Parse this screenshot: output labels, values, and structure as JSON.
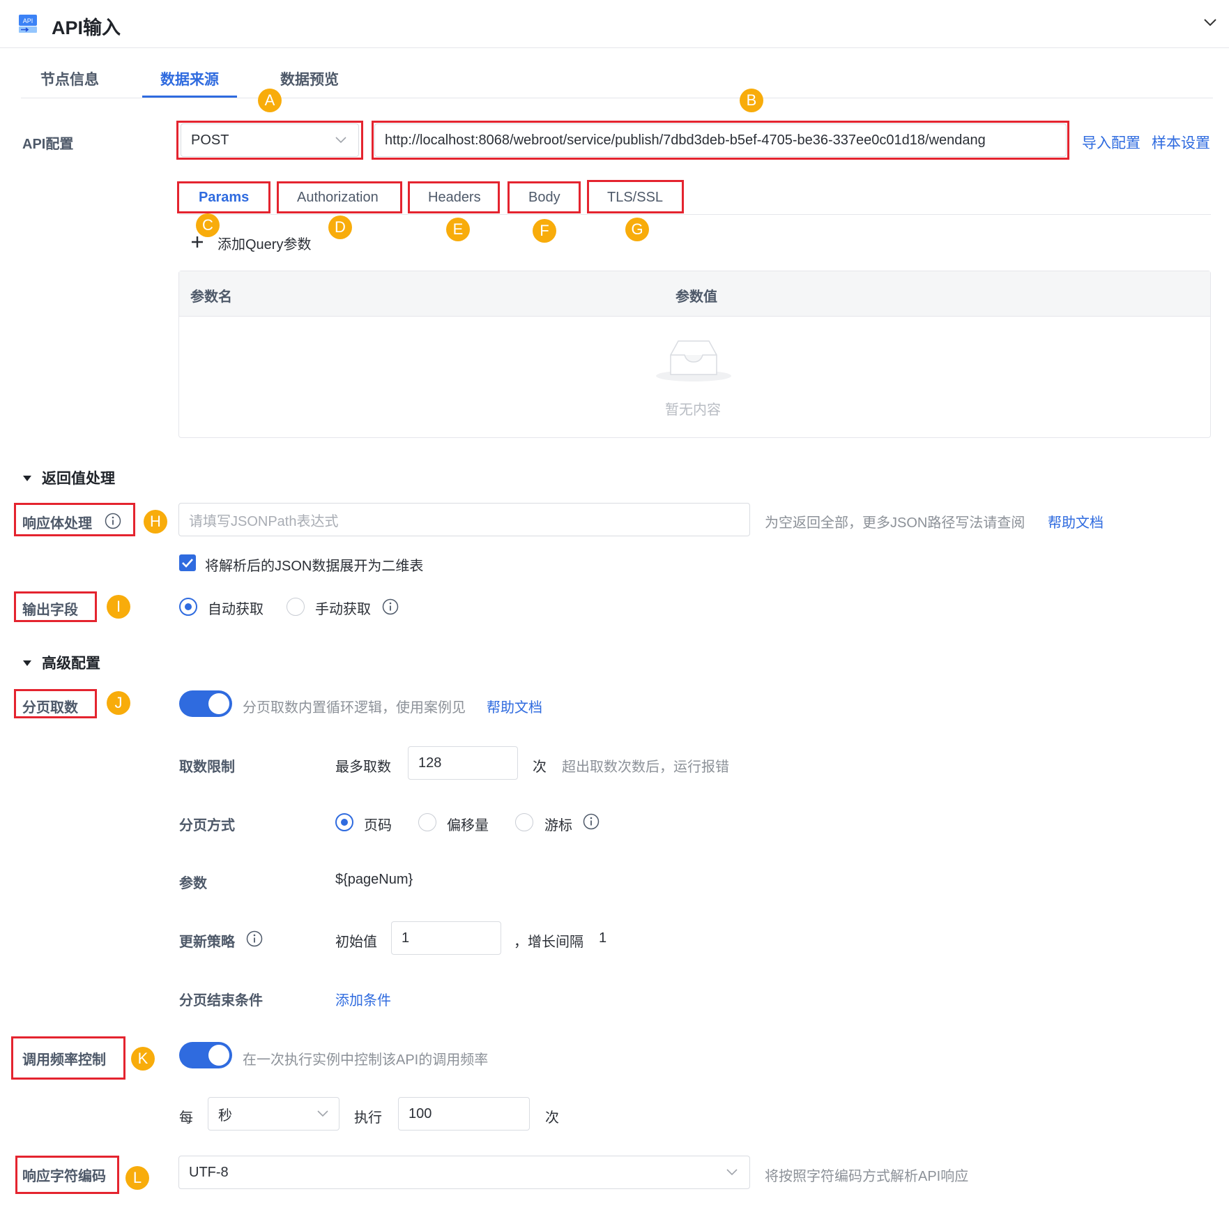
{
  "header": {
    "title": "API输入",
    "icon": "api-icon"
  },
  "tabs": [
    {
      "label": "节点信息",
      "active": false
    },
    {
      "label": "数据来源",
      "active": true
    },
    {
      "label": "数据预览",
      "active": false
    }
  ],
  "api_config": {
    "label": "API配置",
    "method": "POST",
    "url": "http://localhost:8068/webroot/service/publish/7dbd3deb-b5ef-4705-be36-337ee0c01d18/wendang",
    "import_link": "导入配置",
    "sample_link": "样本设置"
  },
  "request_tabs": [
    {
      "label": "Params",
      "active": true
    },
    {
      "label": "Authorization",
      "active": false
    },
    {
      "label": "Headers",
      "active": false
    },
    {
      "label": "Body",
      "active": false
    },
    {
      "label": "TLS/SSL",
      "active": false
    }
  ],
  "params": {
    "add_label": "添加Query参数",
    "columns": [
      "参数名",
      "参数值"
    ],
    "empty_text": "暂无内容"
  },
  "response_section": {
    "title": "返回值处理",
    "body_label": "响应体处理",
    "jsonpath_placeholder": "请填写JSONPath表达式",
    "hint": "为空返回全部，更多JSON路径写法请查阅",
    "help_link": "帮助文档",
    "flatten_checkbox": "将解析后的JSON数据展开为二维表",
    "flatten_checked": true,
    "output_label": "输出字段",
    "output_options": [
      "自动获取",
      "手动获取"
    ],
    "output_selected": "自动获取"
  },
  "advanced_section": {
    "title": "高级配置",
    "paging_label": "分页取数",
    "paging_enabled": true,
    "paging_hint": "分页取数内置循环逻辑，使用案例见",
    "paging_help": "帮助文档",
    "limit_label": "取数限制",
    "limit_prefix": "最多取数",
    "limit_value": "128",
    "limit_unit": "次",
    "limit_hint": "超出取数次数后，运行报错",
    "mode_label": "分页方式",
    "mode_options": [
      "页码",
      "偏移量",
      "游标"
    ],
    "mode_selected": "页码",
    "param_label": "参数",
    "param_value": "${pageNum}",
    "strategy_label": "更新策略",
    "initial_label": "初始值",
    "initial_value": "1",
    "step_label": "，增长间隔",
    "step_value": "1",
    "end_label": "分页结束条件",
    "end_link": "添加条件",
    "rate_label": "调用频率控制",
    "rate_enabled": true,
    "rate_hint": "在一次执行实例中控制该API的调用频率",
    "rate_per": "每",
    "rate_unit": "秒",
    "rate_exec": "执行",
    "rate_value": "100",
    "rate_times": "次",
    "encoding_label": "响应字符编码",
    "encoding_value": "UTF-8",
    "encoding_hint": "将按照字符编码方式解析API响应"
  },
  "annotations": [
    "A",
    "B",
    "C",
    "D",
    "E",
    "F",
    "G",
    "H",
    "I",
    "J",
    "K",
    "L"
  ],
  "colors": {
    "accent": "#2f6bdf",
    "highlight_box": "#e4242f",
    "badge": "#f8ac0b"
  }
}
